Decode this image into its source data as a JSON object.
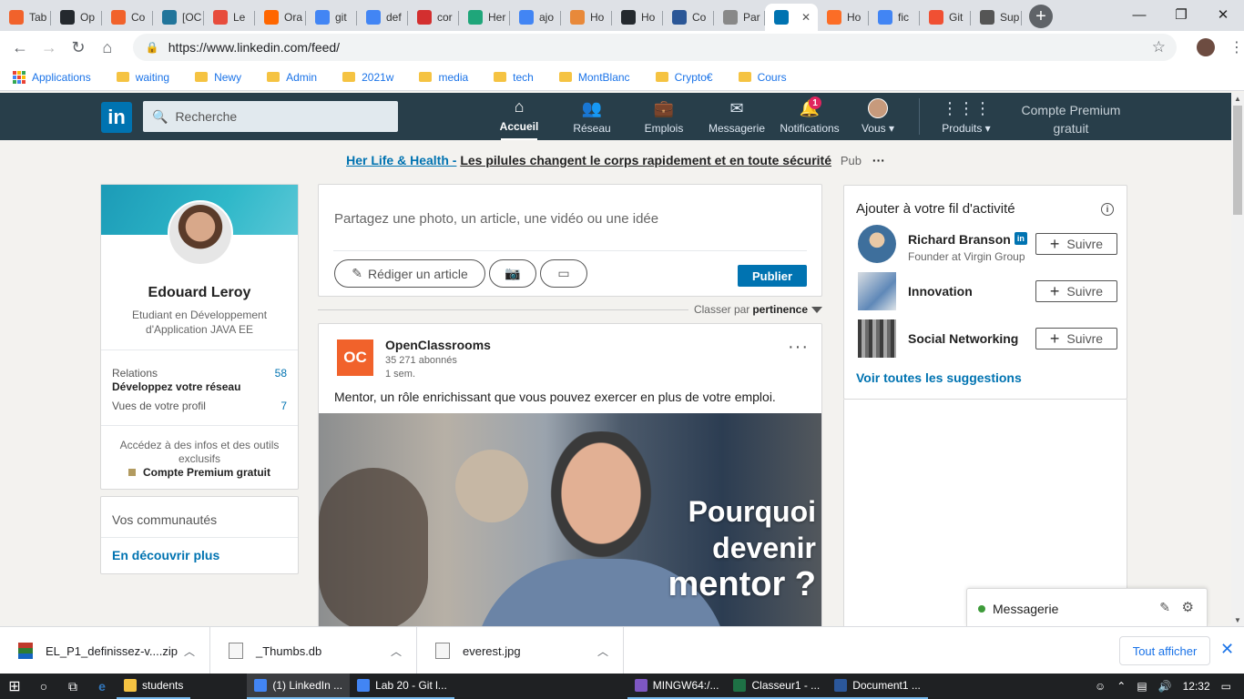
{
  "browser": {
    "tabs": [
      {
        "label": "Tab",
        "color": "#f1622b"
      },
      {
        "label": "Op",
        "color": "#24292e"
      },
      {
        "label": "Co",
        "color": "#f1622b"
      },
      {
        "label": "[OC",
        "color": "#21759b"
      },
      {
        "label": "Le",
        "color": "#e74c3c"
      },
      {
        "label": "Ora",
        "color": "#ff6600"
      },
      {
        "label": "git",
        "color": "#4285f4"
      },
      {
        "label": "def",
        "color": "#4285f4"
      },
      {
        "label": "cor",
        "color": "#d32f2f"
      },
      {
        "label": "Her",
        "color": "#1fa67a"
      },
      {
        "label": "ajo",
        "color": "#4285f4"
      },
      {
        "label": "Ho",
        "color": "#e8893a"
      },
      {
        "label": "Ho",
        "color": "#24292e"
      },
      {
        "label": "Co",
        "color": "#2b5797"
      },
      {
        "label": "Par",
        "color": "#888888"
      },
      {
        "label": "",
        "color": "#0073b1",
        "active": true
      },
      {
        "label": "Ho",
        "color": "#fc6d26"
      },
      {
        "label": "fic",
        "color": "#4285f4"
      },
      {
        "label": "Git",
        "color": "#f05033"
      },
      {
        "label": "Sup",
        "color": "#555555"
      }
    ],
    "url": "https://www.linkedin.com/feed/",
    "bookmarks": [
      "Applications",
      "waiting",
      "Newy",
      "Admin",
      "2021w",
      "media",
      "tech",
      "MontBlanc",
      "Crypto€",
      "Cours"
    ]
  },
  "linkedin": {
    "logo": "in",
    "search_placeholder": "Recherche",
    "nav": [
      {
        "label": "Accueil",
        "icon": "home-icon",
        "glyph": "⌂",
        "active": true
      },
      {
        "label": "Réseau",
        "icon": "network-icon",
        "glyph": "👥"
      },
      {
        "label": "Emplois",
        "icon": "jobs-icon",
        "glyph": "💼"
      },
      {
        "label": "Messagerie",
        "icon": "messaging-icon",
        "glyph": "✉"
      },
      {
        "label": "Notifications",
        "icon": "bell-icon",
        "glyph": "🔔",
        "badge": "1"
      },
      {
        "label": "Vous ▾",
        "icon": "avatar-icon",
        "glyph": "●"
      },
      {
        "label": "Produits ▾",
        "icon": "grid-icon",
        "glyph": "⋮⋮⋮"
      }
    ],
    "premium_nav": [
      "Compte Premium",
      "gratuit"
    ],
    "ad": {
      "head": "Her Life & Health -",
      "text": "Les pilules changent le corps rapidement et en toute sécurité",
      "tag": "Pub",
      "more": "···"
    },
    "profile": {
      "name": "Edouard Leroy",
      "title": "Etudiant en Développement d'Application JAVA EE",
      "relations_label": "Relations",
      "relations_count": "58",
      "grow_label": "Développez votre réseau",
      "views_label": "Vues de votre profil",
      "views_count": "7",
      "premium_intro": "Accédez à des infos et des outils exclusifs",
      "premium_link": "Compte Premium gratuit"
    },
    "communities": {
      "title": "Vos communautés",
      "link": "En découvrir plus"
    },
    "share": {
      "placeholder": "Partagez une photo, un article, une vidéo ou une idée",
      "write_article": "Rédiger un article",
      "publish": "Publier"
    },
    "sort": {
      "label": "Classer par",
      "value": "pertinence"
    },
    "post": {
      "logo": "OC",
      "author": "OpenClassrooms",
      "followers": "35 271 abonnés",
      "time": "1 sem.",
      "text": "Mentor, un rôle enrichissant que vous pouvez exercer en plus de votre emploi.",
      "image_text": [
        "Pourquoi",
        "devenir",
        "mentor ?"
      ],
      "more": "···"
    },
    "follow": {
      "title": "Ajouter à votre fil d'activité",
      "items": [
        {
          "name": "Richard Branson",
          "sub": "Founder at Virgin Group",
          "button": "Suivre"
        },
        {
          "name": "Innovation",
          "sub": "",
          "button": "Suivre"
        },
        {
          "name": "Social Networking",
          "sub": "",
          "button": "Suivre"
        }
      ],
      "see_all": "Voir toutes les suggestions"
    },
    "messaging_bar": {
      "label": "Messagerie"
    }
  },
  "downloads": {
    "items": [
      {
        "name": "EL_P1_definissez-v....zip"
      },
      {
        "name": "_Thumbs.db"
      },
      {
        "name": "everest.jpg"
      }
    ],
    "show_all": "Tout afficher"
  },
  "taskbar": {
    "apps": [
      {
        "label": "students",
        "color": "#f5c342"
      },
      {
        "label": "(1) LinkedIn ...",
        "color": "#4285f4",
        "active": true
      },
      {
        "label": "Lab 20 - Git l...",
        "color": "#4285f4"
      },
      {
        "label": "MINGW64:/...",
        "color": "#7e57c2"
      },
      {
        "label": "Classeur1 - ...",
        "color": "#1e7145"
      },
      {
        "label": "Document1 ...",
        "color": "#2b579a"
      }
    ],
    "time": "12:32"
  }
}
